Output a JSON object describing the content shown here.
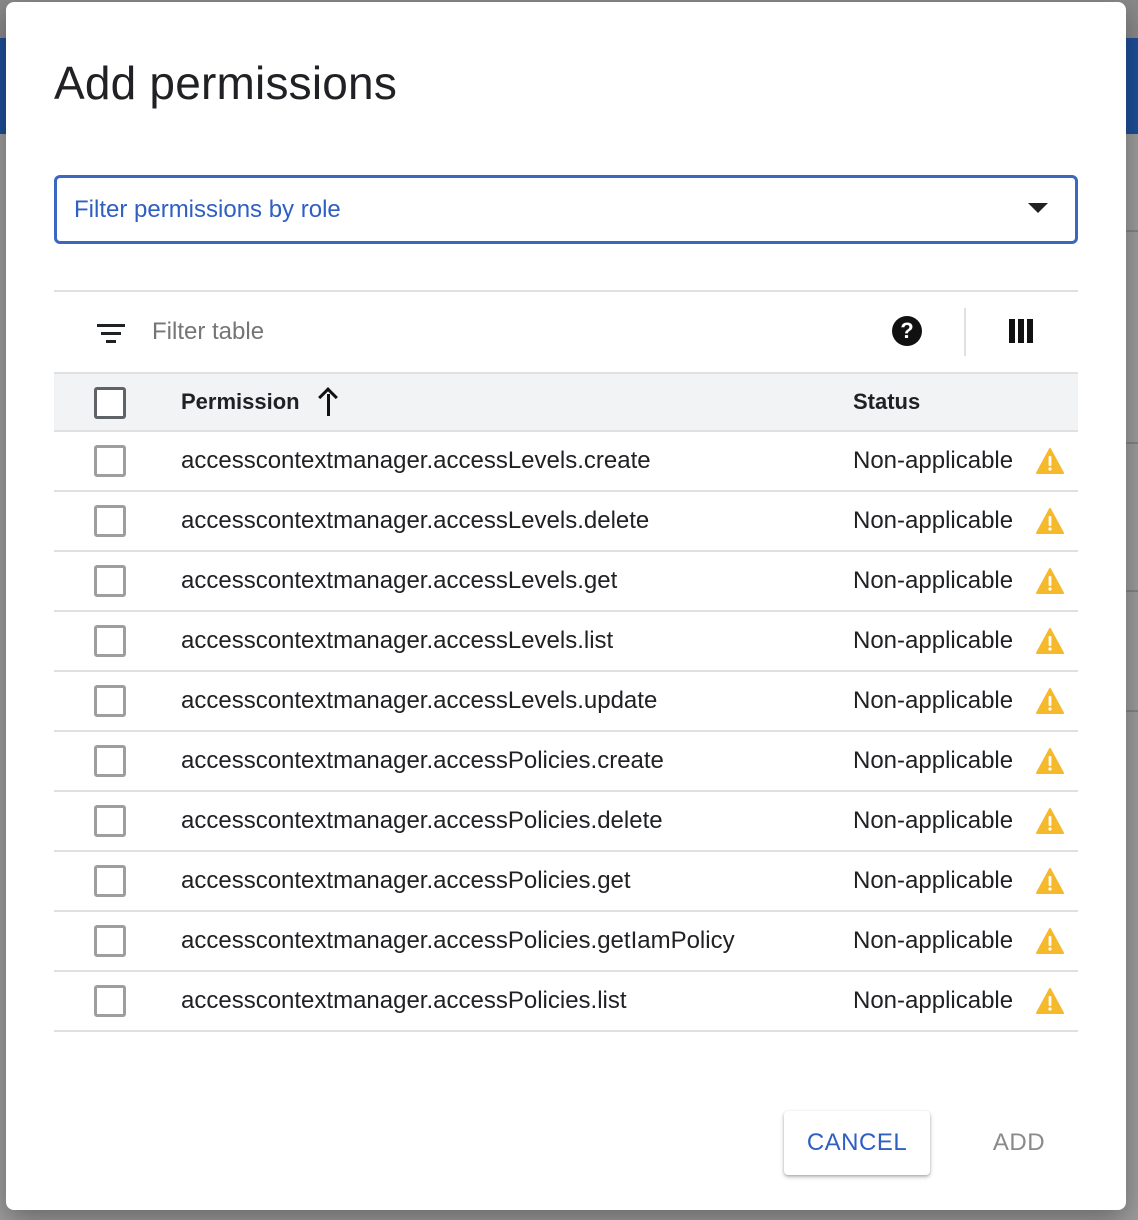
{
  "dialog": {
    "title": "Add permissions",
    "role_filter": {
      "label": "Filter permissions by role"
    },
    "toolbar": {
      "filter_placeholder": "Filter table"
    },
    "table": {
      "columns": {
        "permission": "Permission",
        "status": "Status"
      },
      "rows": [
        {
          "permission": "accesscontextmanager.accessLevels.create",
          "status": "Non-applicable"
        },
        {
          "permission": "accesscontextmanager.accessLevels.delete",
          "status": "Non-applicable"
        },
        {
          "permission": "accesscontextmanager.accessLevels.get",
          "status": "Non-applicable"
        },
        {
          "permission": "accesscontextmanager.accessLevels.list",
          "status": "Non-applicable"
        },
        {
          "permission": "accesscontextmanager.accessLevels.update",
          "status": "Non-applicable"
        },
        {
          "permission": "accesscontextmanager.accessPolicies.create",
          "status": "Non-applicable"
        },
        {
          "permission": "accesscontextmanager.accessPolicies.delete",
          "status": "Non-applicable"
        },
        {
          "permission": "accesscontextmanager.accessPolicies.get",
          "status": "Non-applicable"
        },
        {
          "permission": "accesscontextmanager.accessPolicies.getIamPolicy",
          "status": "Non-applicable"
        },
        {
          "permission": "accesscontextmanager.accessPolicies.list",
          "status": "Non-applicable"
        }
      ]
    },
    "actions": {
      "cancel": "CANCEL",
      "add": "ADD"
    }
  },
  "colors": {
    "accent": "#2f5fc0",
    "warning": "#f6b92b",
    "disabled": "#8a8a8a"
  }
}
